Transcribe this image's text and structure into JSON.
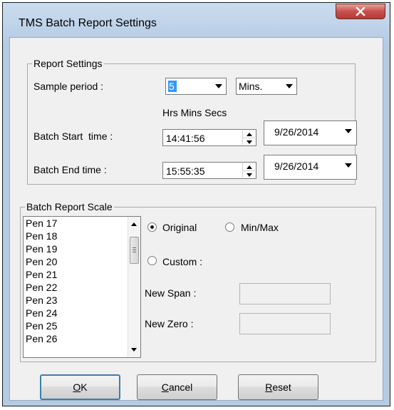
{
  "window": {
    "title": "TMS Batch Report Settings"
  },
  "report_settings": {
    "group_title": "Report Settings",
    "sample_period_label": "Sample period :",
    "sample_period_value": "5",
    "sample_unit_value": "Mins.",
    "time_header": "Hrs Mins Secs",
    "start_label": "Batch Start  time :",
    "start_time": "14:41:56",
    "start_date": "9/26/2014",
    "end_label": "Batch End time :",
    "end_time": "15:55:35",
    "end_date": "9/26/2014"
  },
  "scale": {
    "group_title": "Batch Report Scale",
    "pens": [
      "Pen 17",
      "Pen 18",
      "Pen 19",
      "Pen 20",
      "Pen 21",
      "Pen 22",
      "Pen 23",
      "Pen 24",
      "Pen 25",
      "Pen 26"
    ],
    "original_label": "Original",
    "minmax_label": "Min/Max",
    "custom_label": "Custom :",
    "new_span_label": "New Span :",
    "new_zero_label": "New Zero :",
    "selected": "original"
  },
  "buttons": {
    "ok_mnemonic": "O",
    "ok_rest": "K",
    "cancel_mnemonic": "C",
    "cancel_rest": "ancel",
    "reset_mnemonic": "R",
    "reset_rest": "eset"
  },
  "icons": {
    "close": "close-x-icon",
    "dropdown": "chevron-down-icon",
    "spin_up": "spin-up-icon",
    "spin_down": "spin-down-icon"
  }
}
